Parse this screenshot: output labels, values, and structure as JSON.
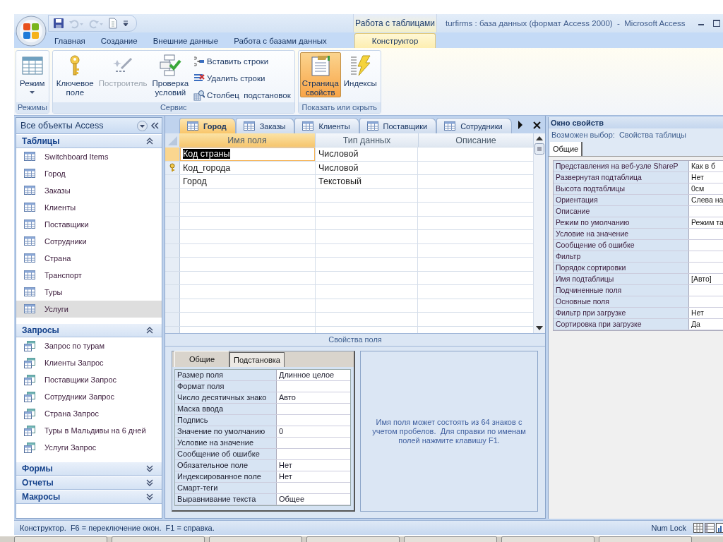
{
  "window": {
    "title": "turfirms : база данных (формат Access 2000)  -  Microsoft Access",
    "context_group": "Работа с таблицами"
  },
  "quick_access": [
    {
      "kind": "save",
      "disabled": false
    },
    {
      "kind": "undo",
      "disabled": true
    },
    {
      "kind": "redo",
      "disabled": true
    },
    {
      "kind": "document",
      "disabled": false
    },
    {
      "kind": "customize",
      "disabled": false
    }
  ],
  "ribbon_tabs": [
    {
      "label": "Главная",
      "selected": false
    },
    {
      "label": "Создание",
      "selected": false
    },
    {
      "label": "Внешние данные",
      "selected": false
    },
    {
      "label": "Работа с базами данных",
      "selected": false
    },
    {
      "label": "Конструктор",
      "selected": true
    }
  ],
  "ribbon_groups": [
    {
      "label": "Режимы",
      "buttons": [
        {
          "kind": "large",
          "label": "Режим",
          "dropdown": true,
          "disabled": false,
          "selected": false
        }
      ]
    },
    {
      "label": "Сервис",
      "buttons": [
        {
          "kind": "large",
          "label": "Ключевое поле",
          "disabled": false,
          "selected": false
        },
        {
          "kind": "large",
          "label": "Построитель",
          "disabled": true,
          "selected": false
        },
        {
          "kind": "large",
          "label": "Проверка условий",
          "disabled": false,
          "selected": false
        },
        {
          "kind": "small",
          "label": "Вставить строки",
          "disabled": false,
          "selected": false
        },
        {
          "kind": "small",
          "label": "Удалить строки",
          "disabled": false,
          "selected": false
        },
        {
          "kind": "small",
          "label": "Столбец  подстановок",
          "disabled": false,
          "selected": false
        }
      ]
    },
    {
      "label": "Показать или скрыть",
      "buttons": [
        {
          "kind": "large",
          "label": "Страница свойств",
          "disabled": false,
          "selected": true
        },
        {
          "kind": "large",
          "label": "Индексы",
          "disabled": false,
          "selected": false
        }
      ]
    }
  ],
  "navigation": {
    "title": "Все объекты Access",
    "groups": [
      {
        "label": "Таблицы",
        "kind": "table",
        "expanded": true,
        "items": [
          {
            "label": "Switchboard Items",
            "selected": false
          },
          {
            "label": "Город",
            "selected": false
          },
          {
            "label": "Заказы",
            "selected": false
          },
          {
            "label": "Клиенты",
            "selected": false
          },
          {
            "label": "Поставщики",
            "selected": false
          },
          {
            "label": "Сотрудники",
            "selected": false
          },
          {
            "label": "Страна",
            "selected": false
          },
          {
            "label": "Транспорт",
            "selected": false
          },
          {
            "label": "Туры",
            "selected": false
          },
          {
            "label": "Услуги",
            "selected": true
          }
        ]
      },
      {
        "label": "Запросы",
        "kind": "query",
        "expanded": true,
        "items": [
          {
            "label": "Запрос по турам",
            "selected": false
          },
          {
            "label": "Клиенты Запрос",
            "selected": false
          },
          {
            "label": "Поставщики Запрос",
            "selected": false
          },
          {
            "label": "Сотрудники Запрос",
            "selected": false
          },
          {
            "label": "Страна Запрос",
            "selected": false
          },
          {
            "label": "Туры в Мальдивы на 6 дней",
            "selected": false
          },
          {
            "label": "Услуги Запрос",
            "selected": false
          }
        ]
      },
      {
        "label": "Формы",
        "expanded": false
      },
      {
        "label": "Отчеты",
        "expanded": false
      },
      {
        "label": "Макросы",
        "expanded": false
      }
    ]
  },
  "document_tabs": [
    {
      "label": "Город",
      "selected": true
    },
    {
      "label": "Заказы",
      "selected": false
    },
    {
      "label": "Клиенты",
      "selected": false
    },
    {
      "label": "Поставщики",
      "selected": false
    },
    {
      "label": "Сотрудники",
      "selected": false
    }
  ],
  "design_grid": {
    "columns": [
      "Имя поля",
      "Тип данных",
      "Описание"
    ],
    "rows": [
      {
        "field_name": "Код страны",
        "data_type": "Числовой",
        "primary_key": false,
        "selected": true
      },
      {
        "field_name": "Код_города",
        "data_type": "Числовой",
        "primary_key": true,
        "selected": false
      },
      {
        "field_name": "Город",
        "data_type": "Текстовый",
        "primary_key": false,
        "selected": false
      }
    ]
  },
  "field_properties": {
    "title": "Свойства поля",
    "tabs": [
      {
        "label": "Общие",
        "selected": true
      },
      {
        "label": "Подстановка",
        "selected": false
      }
    ],
    "rows": [
      {
        "label": "Размер поля",
        "value": "Длинное целое"
      },
      {
        "label": "Формат поля"
      },
      {
        "label": "Число десятичных знако",
        "value": "Авто"
      },
      {
        "label": "Маска ввода"
      },
      {
        "label": "Подпись"
      },
      {
        "label": "Значение по умолчанию",
        "value": "0"
      },
      {
        "label": "Условие на значение"
      },
      {
        "label": "Сообщение об ошибке"
      },
      {
        "label": "Обязательное поле",
        "value": "Нет"
      },
      {
        "label": "Индексированное поле",
        "value": "Нет"
      },
      {
        "label": "Смарт-теги"
      },
      {
        "label": "Выравнивание текста",
        "value": "Общее"
      }
    ],
    "help": "Имя поля может состоять из 64 знаков с учетом пробелов.  Для справки по именам полей нажмите клавишу F1."
  },
  "property_sheet": {
    "title": "Окно свойств",
    "selection_label": "Возможен выбор:",
    "selection": "Свойства таблицы",
    "tabs": [
      {
        "label": "Общие",
        "selected": true
      }
    ],
    "rows": [
      {
        "label": "Представления на веб-узле ShareP",
        "value": "Как в б"
      },
      {
        "label": "Развернутая подтаблица",
        "value": "Нет"
      },
      {
        "label": "Высота подтаблицы",
        "value": "0см"
      },
      {
        "label": "Ориентация",
        "value": "Слева на"
      },
      {
        "label": "Описание"
      },
      {
        "label": "Режим по умолчанию",
        "value": "Режим та"
      },
      {
        "label": "Условие на значение"
      },
      {
        "label": "Сообщение об ошибке"
      },
      {
        "label": "Фильтр"
      },
      {
        "label": "Порядок сортировки"
      },
      {
        "label": "Имя подтаблицы",
        "value": "[Авто]"
      },
      {
        "label": "Подчиненные поля"
      },
      {
        "label": "Основные поля"
      },
      {
        "label": "Фильтр при загрузке",
        "value": "Нет"
      },
      {
        "label": "Сортировка при загрузке",
        "value": "Да"
      }
    ]
  },
  "status_bar": {
    "text": "Конструктор.  F6 = переключение окон.  F1 = справка.",
    "num_lock": "Num Lock"
  }
}
